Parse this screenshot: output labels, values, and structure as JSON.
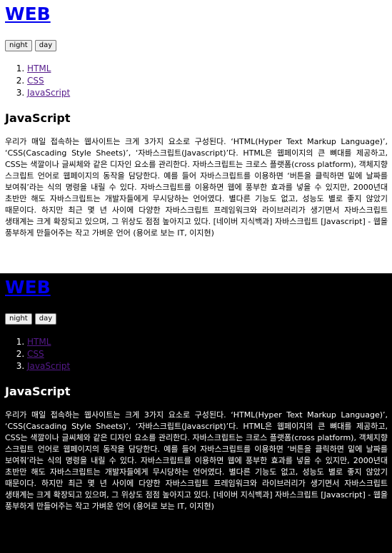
{
  "site": {
    "title": "WEB"
  },
  "buttons": {
    "night": "night",
    "day": "day"
  },
  "nav": {
    "items": [
      {
        "label": "HTML"
      },
      {
        "label": "CSS"
      },
      {
        "label": "JavaScript"
      }
    ]
  },
  "article": {
    "heading": "JavaScript",
    "body": "우리가 매일 접속하는 웹사이트는 크게 3가지 요소로 구성된다. ‘HTML(Hyper Text Markup Language)’, ‘CSS(Cascading Style Sheets)’, ‘자바스크립트(Javascript)’다. HTML은 웹페이지의 큰 뼈대를 제공하고, CSS는 색깔이나 글씨체와 같은 디자인 요소를 관리한다. 자바스크립트는 크로스 플랫폼(cross platform), 객체지향 스크립트 언어로 웹페이지의 동작을 담당한다. 예를 들어 자바스크립트를 이용하면 ‘버튼을 클릭하면 밑에 날짜를 보여줘’라는 식의 명령을 내릴 수 있다. 자바스크립트를 이용하면 웹에 풍부한 효과를 넣을 수 있지만, 2000년대 초반만 해도 자바스크립트는 개발자들에게 무시당하는 언어였다. 별다른 기능도 없고, 성능도 별로 좋지 않았기 때문이다. 하지만 최근 몇 년 사이에 다양한 자바스크립트 프레임워크와 라이브러리가 생기면서 자바스크립트 생태계는 크게 확장되고 있으며, 그 위상도 점점 높아지고 있다. [네이버 지식백과] 자바스크립트 [Javascript] - 웹을 풍부하게 만들어주는 작고 가벼운 언어 (용어로 보는 IT, 이지현)"
  },
  "colors": {
    "light_background": "#ffffff",
    "dark_background": "#000000",
    "link": "#0000ee",
    "visited_link": "#551a8b"
  }
}
